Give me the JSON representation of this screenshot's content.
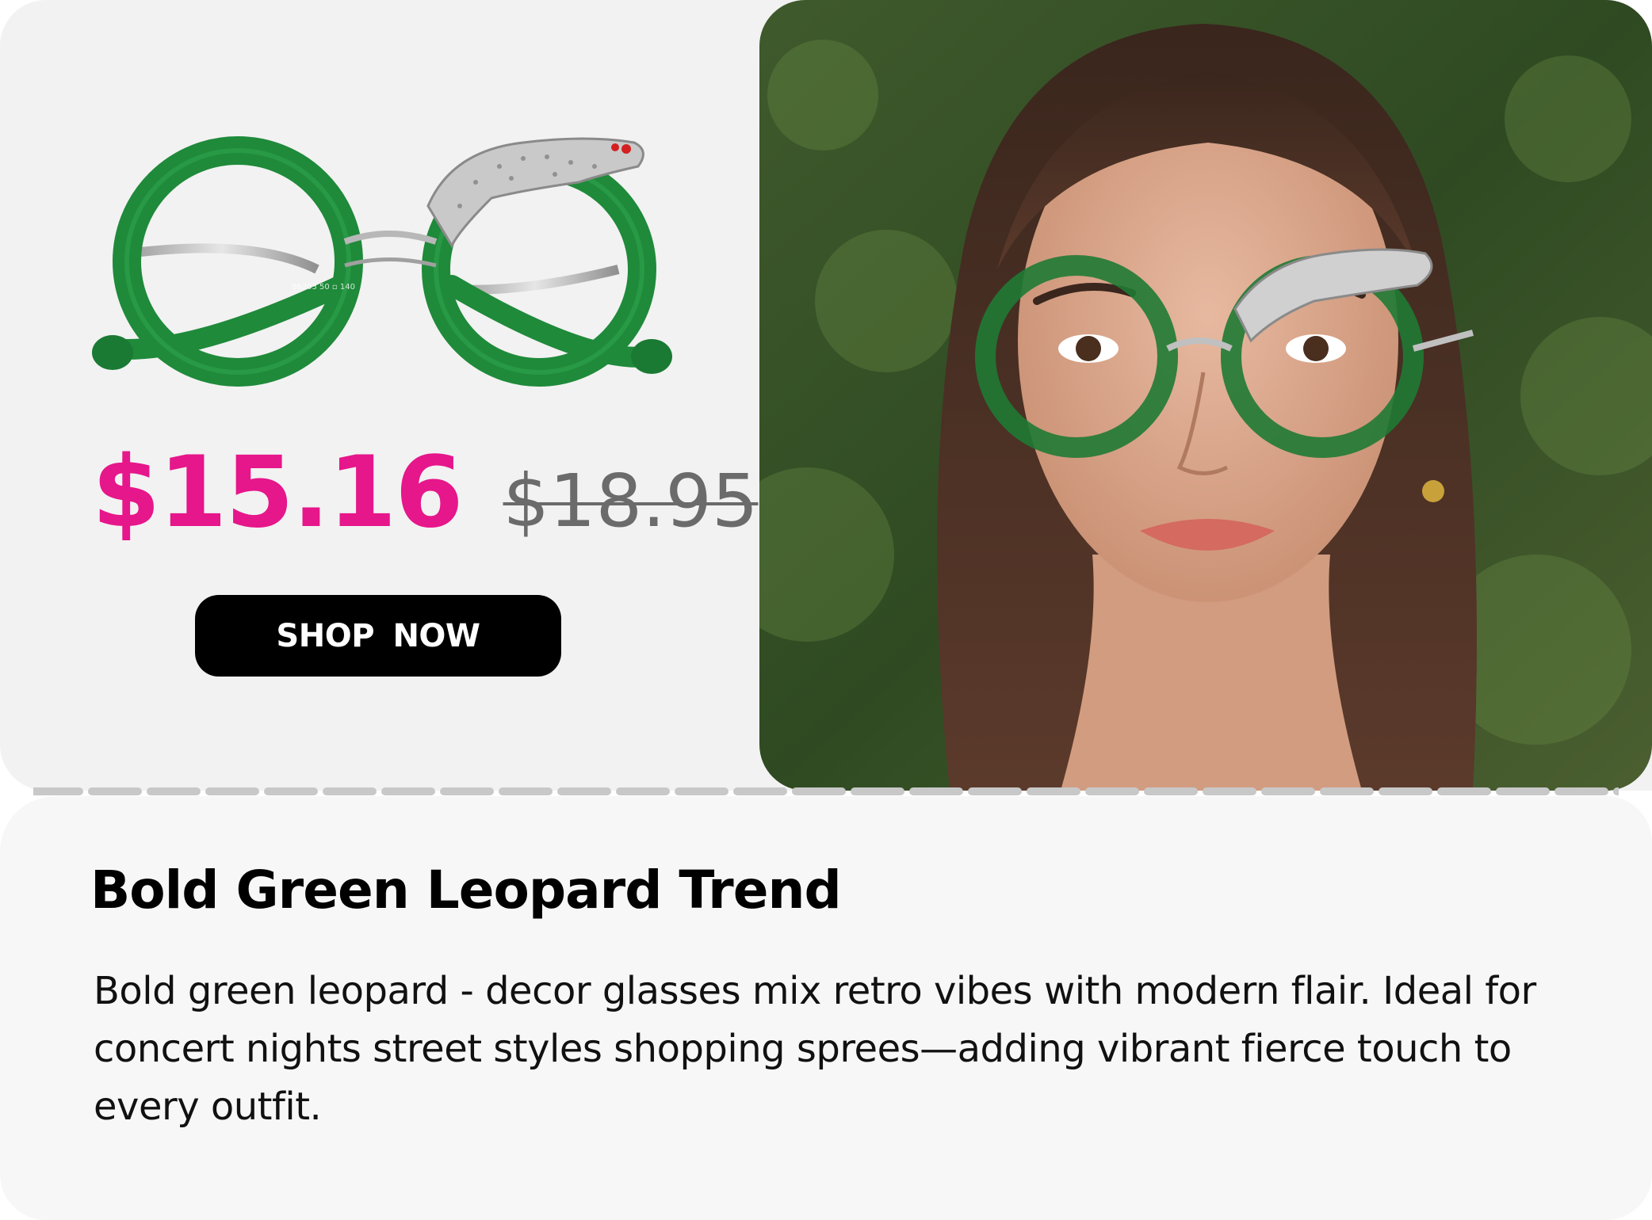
{
  "product": {
    "price_current": "$15.16",
    "price_original": "$18.95",
    "cta_label": "SHOP NOW",
    "frame_code_text": "86203 50 ▫ 140"
  },
  "info": {
    "title": "Bold Green Leopard Trend",
    "description": "Bold green leopard - decor glasses mix retro vibes with modern flair. Ideal for concert nights street styles shopping sprees—adding vibrant fierce touch to every outfit."
  },
  "colors": {
    "accent_price": "#e6168b",
    "old_price": "#6b6b6b",
    "button_bg": "#000000",
    "frame_green": "#1f8a3a",
    "panel_bg": "#f2f2f2"
  },
  "icons": {
    "product_image": "green-round-glasses-with-leopard-decor",
    "model_photo": "woman-wearing-green-leopard-glasses"
  }
}
